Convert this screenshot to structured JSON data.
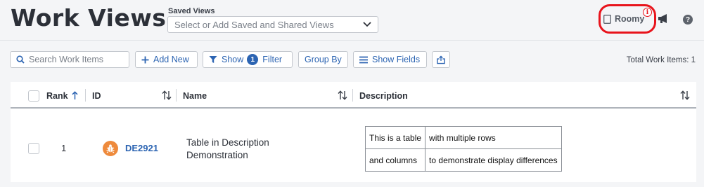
{
  "header": {
    "title": "Work Views",
    "saved_views_label": "Saved Views",
    "saved_views_placeholder": "Select or Add Saved and Shared Views",
    "density_label": "Roomy",
    "info_glyph": "i",
    "help_glyph": "?"
  },
  "toolbar": {
    "search_placeholder": "Search Work Items",
    "add_new_label": "Add New",
    "show_label": "Show",
    "filter_count": "1",
    "filter_label": "Filter",
    "group_by_label": "Group By",
    "show_fields_label": "Show Fields",
    "total_label": "Total Work Items: 1"
  },
  "grid": {
    "columns": {
      "rank": "Rank",
      "id": "ID",
      "name": "Name",
      "description": "Description"
    },
    "rows": [
      {
        "rank": "1",
        "id": "DE2921",
        "name_line1": "Table in Description",
        "name_line2": "Demonstration",
        "description_table": [
          [
            "This is a table",
            "with multiple rows"
          ],
          [
            "and columns",
            "to demonstrate display differences"
          ]
        ]
      }
    ]
  },
  "colors": {
    "accent": "#2c64b2",
    "highlight_ring": "#e8141c",
    "defect_badge": "#ee8a3c"
  },
  "icons": [
    "document-icon",
    "info-icon",
    "megaphone-icon",
    "help-icon",
    "search-icon",
    "plus-icon",
    "filter-icon",
    "list-icon",
    "share-icon",
    "sort-icon",
    "bug-icon",
    "chevron-down-icon"
  ]
}
